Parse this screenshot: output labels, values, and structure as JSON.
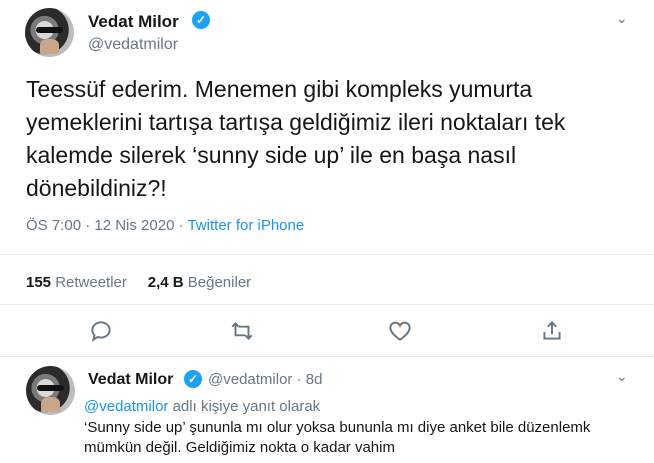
{
  "tweet": {
    "author_name": "Vedat Milor",
    "author_handle": "@vedatmilor",
    "text": "Teessüf ederim. Menemen gibi kompleks yumurta yemeklerini tartışa tartışa geldiğimiz ileri noktaları tek kalemde silerek ‘sunny side up’ ile en başa nasıl dönebildiniz?!",
    "time": "ÖS 7:00 · 12 Nis 2020 · ",
    "source": "Twitter for iPhone",
    "retweets_count": "155",
    "retweets_label": " Retweetler",
    "likes_count": "2,4 B",
    "likes_label": " Beğeniler"
  },
  "reply": {
    "author_name": "Vedat Milor",
    "author_handle": "@vedatmilor · 8d",
    "reply_to_mention": "@vedatmilor",
    "reply_to_suffix": " adlı kişiye yanıt olarak",
    "text": "‘Sunny side up’ şununla mı olur yoksa bununla mı diye anket bile düzenlemk mümkün değil. Geldiğimiz nokta o kadar vahim"
  },
  "icons": {
    "verified": "verified-badge-icon",
    "chevron": "chevron-down-icon",
    "reply": "reply-icon",
    "retweet": "retweet-icon",
    "like": "heart-icon",
    "share": "share-icon"
  },
  "colors": {
    "link": "#1b95e0",
    "verified": "#1da1f2",
    "muted": "#657786"
  }
}
